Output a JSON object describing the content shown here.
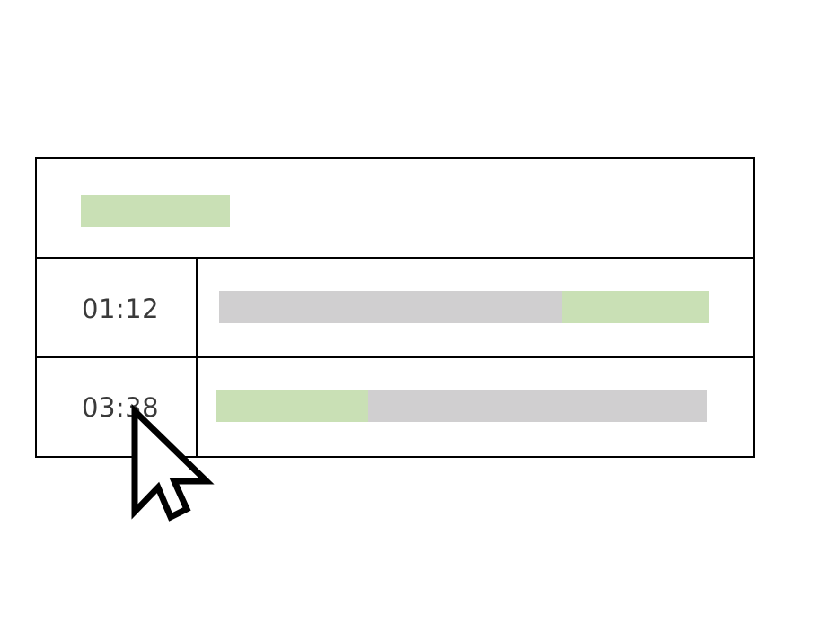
{
  "colors": {
    "accent_green": "#c9e0b5",
    "track_gray": "#d0cfd0",
    "border": "#000000",
    "text": "#3a3a3a"
  },
  "header": {
    "swatch_color": "#c9e0b5"
  },
  "rows": [
    {
      "time": "01:12",
      "segments": [
        {
          "color": "#d0cfd0",
          "start": 0.0,
          "end": 0.7
        },
        {
          "color": "#c9e0b5",
          "start": 0.7,
          "end": 1.0
        }
      ]
    },
    {
      "time": "03:38",
      "segments": [
        {
          "color": "#c9e0b5",
          "start": 0.0,
          "end": 0.31
        },
        {
          "color": "#d0cfd0",
          "start": 0.31,
          "end": 1.0
        }
      ]
    }
  ],
  "cursor": {
    "icon": "arrow-pointer-icon"
  }
}
